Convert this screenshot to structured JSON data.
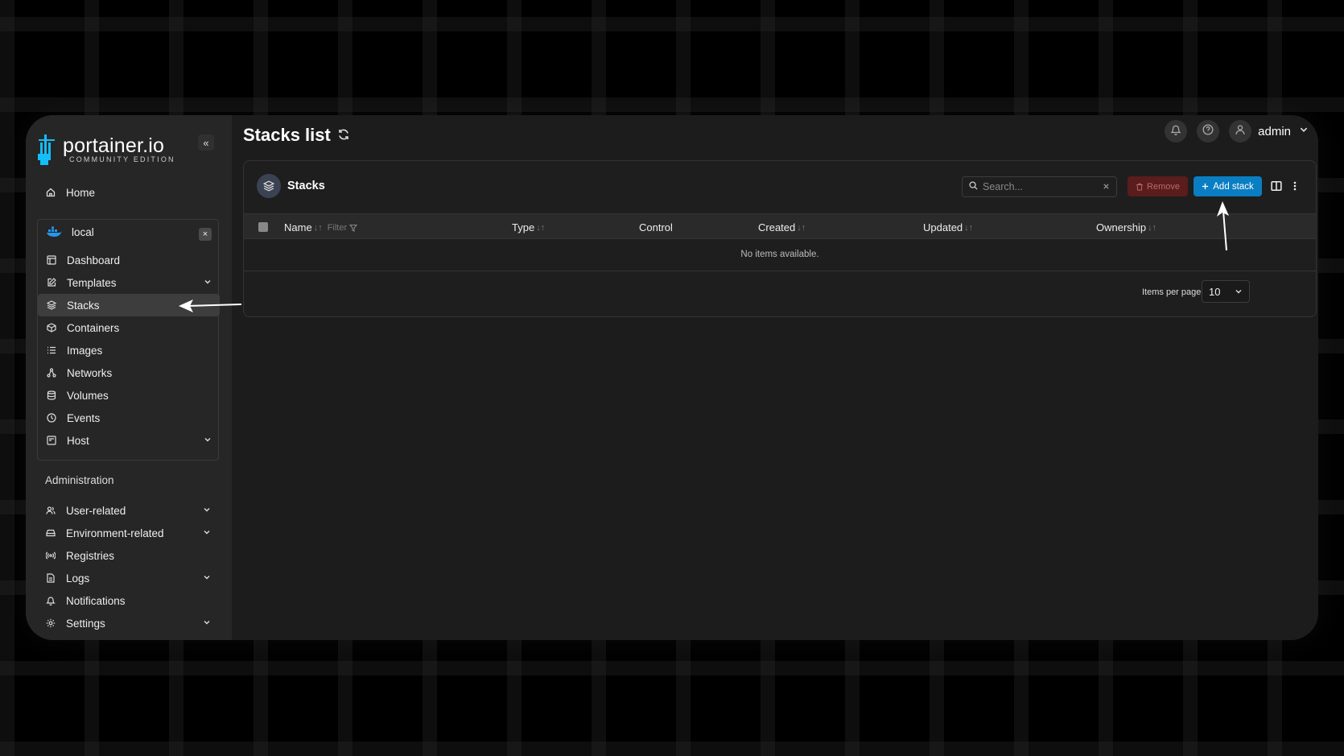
{
  "brand": {
    "name": "portainer.io",
    "edition": "COMMUNITY EDITION"
  },
  "sidebar": {
    "collapse_icon": "«",
    "home": "Home",
    "environment": {
      "name": "local",
      "close": "×"
    },
    "env_items": [
      {
        "label": "Dashboard"
      },
      {
        "label": "Templates"
      },
      {
        "label": "Stacks"
      },
      {
        "label": "Containers"
      },
      {
        "label": "Images"
      },
      {
        "label": "Networks"
      },
      {
        "label": "Volumes"
      },
      {
        "label": "Events"
      },
      {
        "label": "Host"
      }
    ],
    "admin_title": "Administration",
    "admin_items": [
      {
        "label": "User-related"
      },
      {
        "label": "Environment-related"
      },
      {
        "label": "Registries"
      },
      {
        "label": "Logs"
      },
      {
        "label": "Notifications"
      },
      {
        "label": "Settings"
      }
    ]
  },
  "header": {
    "title": "Stacks list",
    "user": "admin"
  },
  "panel": {
    "title": "Stacks",
    "search_placeholder": "Search...",
    "remove_label": "Remove",
    "add_label": "Add stack",
    "columns": {
      "name": "Name",
      "filter": "Filter",
      "type": "Type",
      "control": "Control",
      "created": "Created",
      "updated": "Updated",
      "ownership": "Ownership"
    },
    "sort_glyph": "↓↑",
    "empty": "No items available.",
    "items_per_page_label": "Items per page",
    "items_per_page": "10"
  },
  "colors": {
    "accent": "#0a7ec2",
    "danger": "#5a1c1c",
    "sidebar": "#262626",
    "main": "#1c1c1c"
  }
}
